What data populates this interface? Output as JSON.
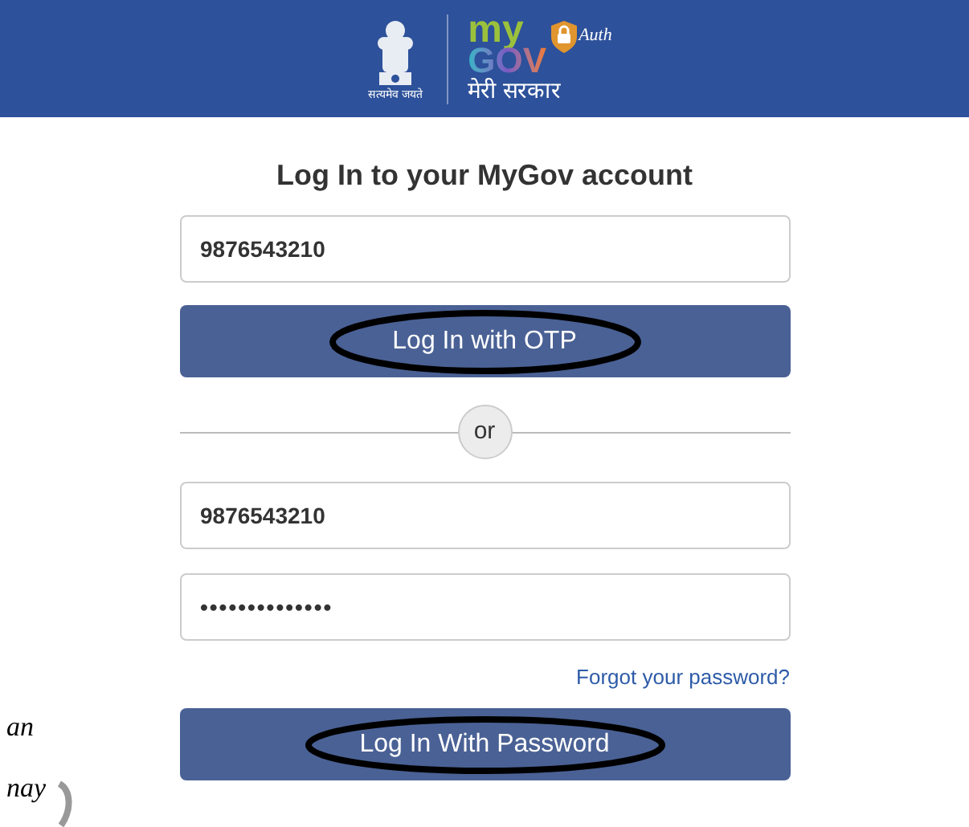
{
  "header": {
    "emblem_motto": "सत्यमेव जयते",
    "logo_my": "my",
    "logo_gov": "GOV",
    "logo_tagline": "मेरी सरकार",
    "auth_label": "Auth"
  },
  "title": "Log In to your MyGov account",
  "otp_form": {
    "mobile": {
      "value": "9876543210"
    },
    "button": {
      "label": "Log In with OTP",
      "circled": true
    }
  },
  "separator": "or",
  "password_form": {
    "username": {
      "value": "9876543210"
    },
    "password": {
      "value": "••••••••••••••"
    },
    "forgot_link": "Forgot your password?",
    "button": {
      "label": "Log In With Password",
      "circled": true
    }
  },
  "handwritten_notes": [
    {
      "text": "an"
    },
    {
      "text": "nay"
    }
  ]
}
